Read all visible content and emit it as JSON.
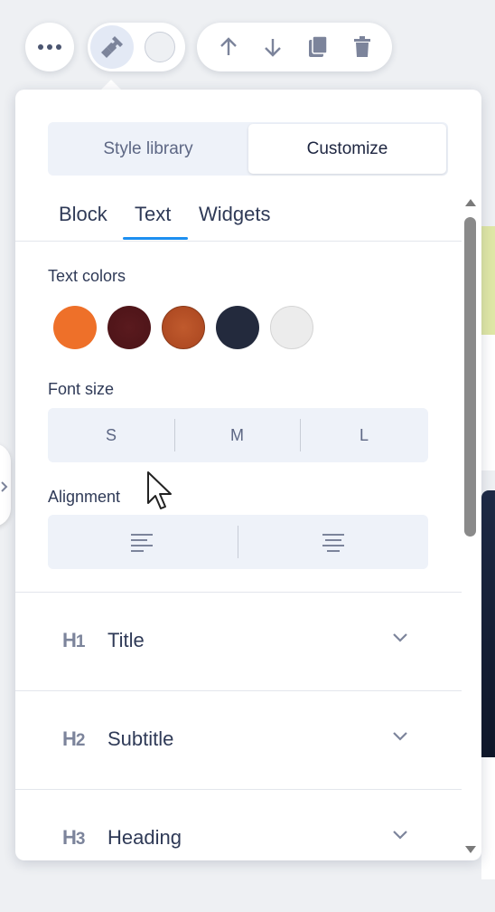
{
  "toolbar": {
    "more_icon": "more-horizontal-icon",
    "style_icon": "paint-brush-icon",
    "actions": [
      "arrow-up-icon",
      "arrow-down-icon",
      "duplicate-icon",
      "trash-icon"
    ]
  },
  "panel": {
    "segments": {
      "library": "Style library",
      "customize": "Customize"
    },
    "tabs": {
      "block": "Block",
      "text": "Text",
      "widgets": "Widgets",
      "active": "Text"
    },
    "text_colors": {
      "label": "Text colors",
      "swatches": [
        "#ee7029",
        "#4b1317",
        "#a9451f",
        "#232a3d",
        "#ececec"
      ]
    },
    "font_size": {
      "label": "Font size",
      "options": {
        "s": "S",
        "m": "M",
        "l": "L"
      }
    },
    "alignment": {
      "label": "Alignment",
      "options": [
        "align-left-icon",
        "align-center-icon"
      ]
    },
    "headings": [
      {
        "badge": "H",
        "num": "1",
        "label": "Title"
      },
      {
        "badge": "H",
        "num": "2",
        "label": "Subtitle"
      },
      {
        "badge": "H",
        "num": "3",
        "label": "Heading"
      }
    ]
  },
  "colors": {
    "accent": "#1d8ff0",
    "text": "#2f3a57",
    "muted": "#5d6784"
  }
}
